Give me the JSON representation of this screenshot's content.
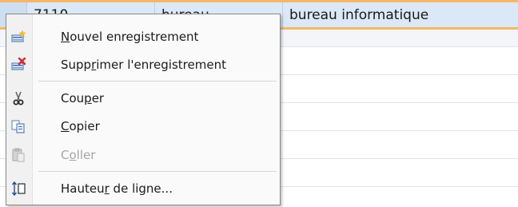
{
  "selected_row": {
    "c1": "7110",
    "c2": "bureau",
    "c3": "bureau informatique"
  },
  "context_menu": {
    "new_record": {
      "pre": "",
      "acc": "N",
      "post": "ouvel enregistrement"
    },
    "delete_record": {
      "pre": "Supp",
      "acc": "r",
      "post": "imer l'enregistrement"
    },
    "cut": {
      "pre": "Cou",
      "acc": "p",
      "post": "er"
    },
    "copy": {
      "pre": "",
      "acc": "C",
      "post": "opier"
    },
    "paste": {
      "pre": "C",
      "acc": "o",
      "post": "ller",
      "disabled": true
    },
    "row_height": {
      "pre": "Hauteu",
      "acc": "r",
      "post": " de ligne..."
    }
  }
}
